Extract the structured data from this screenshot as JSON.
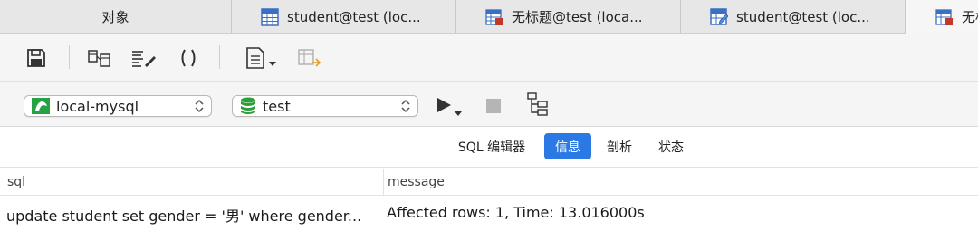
{
  "tabs": [
    {
      "label": "对象",
      "icon": "none",
      "active": false
    },
    {
      "label": "student@test (loc...",
      "icon": "table-icon",
      "active": false
    },
    {
      "label": "无标题@test (loca...",
      "icon": "query-icon",
      "active": false
    },
    {
      "label": "student@test (loc...",
      "icon": "table-edit-icon",
      "active": false
    },
    {
      "label": "无标",
      "icon": "query-icon",
      "active": true
    }
  ],
  "connection": {
    "selected": "local-mysql",
    "icon": "mysql-connection-icon"
  },
  "database": {
    "selected": "test",
    "icon": "database-icon"
  },
  "result_tabs": [
    {
      "label": "SQL 编辑器",
      "selected": false
    },
    {
      "label": "信息",
      "selected": true
    },
    {
      "label": "剖析",
      "selected": false
    },
    {
      "label": "状态",
      "selected": false
    }
  ],
  "result_table": {
    "columns": [
      "sql",
      "message"
    ],
    "rows": [
      [
        "update student set gender = '男' where gender...",
        "Affected rows: 1, Time: 13.016000s"
      ]
    ]
  },
  "colors": {
    "accent": "#2b79e5",
    "mysql_green": "#25a244",
    "db_green": "#2e9e3a"
  }
}
